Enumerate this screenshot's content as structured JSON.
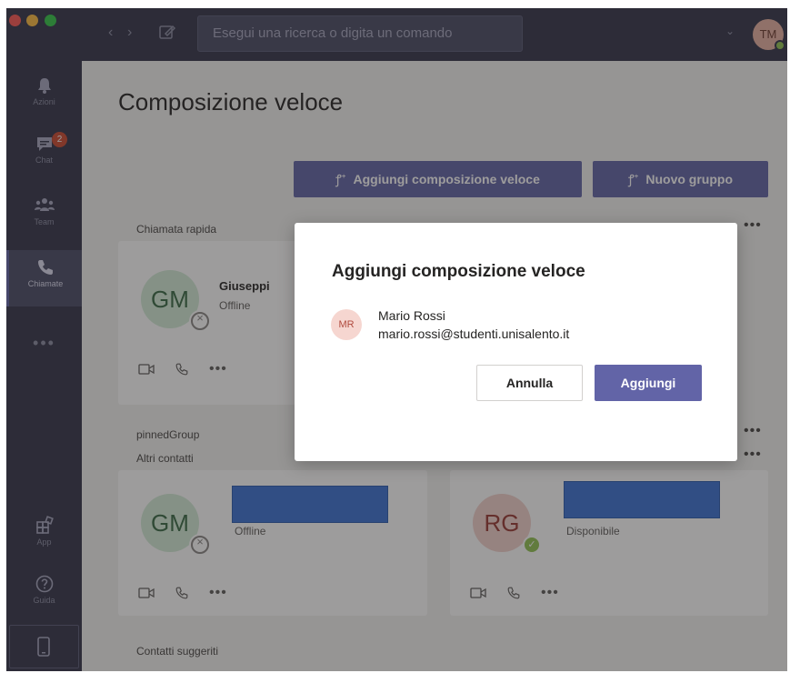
{
  "titlebar": {
    "search_placeholder": "Esegui una ricerca o digita un comando",
    "user_initials": "TM",
    "back_glyph": "‹",
    "forward_glyph": "›",
    "chevron_glyph": "⌄"
  },
  "rail": {
    "items": [
      {
        "label": "Azioni",
        "icon": "bell-icon"
      },
      {
        "label": "Chat",
        "icon": "chat-icon",
        "badge": "2"
      },
      {
        "label": "Team",
        "icon": "teams-icon"
      },
      {
        "label": "Chiamate",
        "icon": "phone-icon"
      },
      {
        "label": "App",
        "icon": "apps-icon"
      },
      {
        "label": "Guida",
        "icon": "help-icon"
      }
    ],
    "more": "•••"
  },
  "main": {
    "title": "Composizione veloce",
    "add_speed_dial_label": "Aggiungi composizione veloce",
    "new_group_label": "Nuovo gruppo",
    "button_icon_glyph": "ꝭ⁺",
    "sections": {
      "quick_call": "Chiamata rapida",
      "pinned_group": "pinnedGroup",
      "other_contacts": "Altri contatti",
      "suggested_contacts": "Contatti suggeriti"
    },
    "more_glyph": "•••",
    "cards": [
      {
        "initials": "GM",
        "name": "Giuseppi",
        "status": "Offline",
        "presence": "offline"
      },
      {
        "initials": "GM",
        "name": "",
        "status": "Offline",
        "presence": "offline"
      },
      {
        "initials": "RG",
        "name": "",
        "status": "Disponibile",
        "presence": "available"
      }
    ]
  },
  "dialog": {
    "title": "Aggiungi composizione veloce",
    "contact_initials": "MR",
    "contact_name": "Mario Rossi",
    "contact_email": "mario.rossi@studenti.unisalento.it",
    "cancel_label": "Annulla",
    "add_label": "Aggiungi"
  },
  "colors": {
    "accent": "#6264a7",
    "rail_bg": "#33344a",
    "available": "#92c353",
    "badge": "#cc4a31",
    "redaction": "#3b72d4"
  }
}
